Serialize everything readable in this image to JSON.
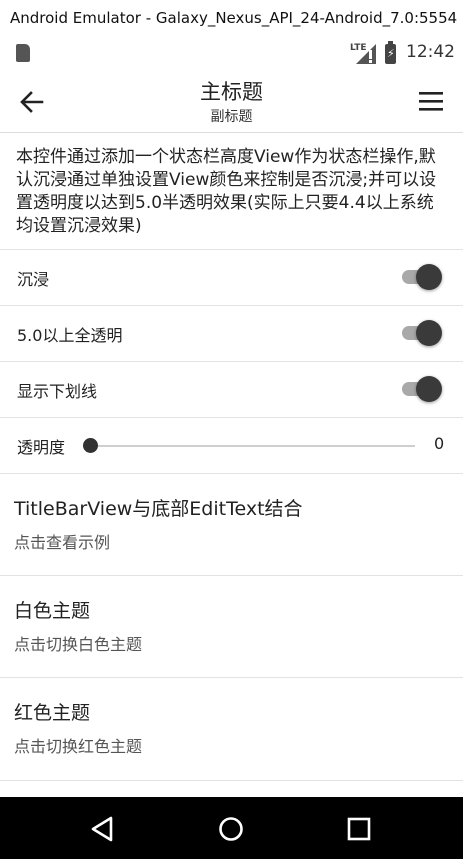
{
  "window": {
    "title": "Android Emulator - Galaxy_Nexus_API_24-Android_7.0:5554"
  },
  "status_bar": {
    "network": "LTE",
    "time": "12:42"
  },
  "title_bar": {
    "title": "主标题",
    "subtitle": "副标题"
  },
  "description": "本控件通过添加一个状态栏高度View作为状态栏操作,默认沉浸通过单独设置View颜色来控制是否沉浸;并可以设置透明度以达到5.0半透明效果(实际上只要4.4以上系统均设置沉浸效果)",
  "settings": [
    {
      "label": "沉浸",
      "on": true
    },
    {
      "label": "5.0以上全透明",
      "on": true
    },
    {
      "label": "显示下划线",
      "on": true
    }
  ],
  "transparency": {
    "label": "透明度",
    "value": "0",
    "fraction": 0
  },
  "list_items": [
    {
      "title": "TitleBarView与底部EditText结合",
      "subtitle": "点击查看示例"
    },
    {
      "title": "白色主题",
      "subtitle": "点击切换白色主题"
    },
    {
      "title": "红色主题",
      "subtitle": "点击切换红色主题"
    }
  ],
  "colors": {
    "switch_thumb": "#3a3a3a",
    "switch_track": "#a9a9a9",
    "nav_bar": "#000000"
  }
}
